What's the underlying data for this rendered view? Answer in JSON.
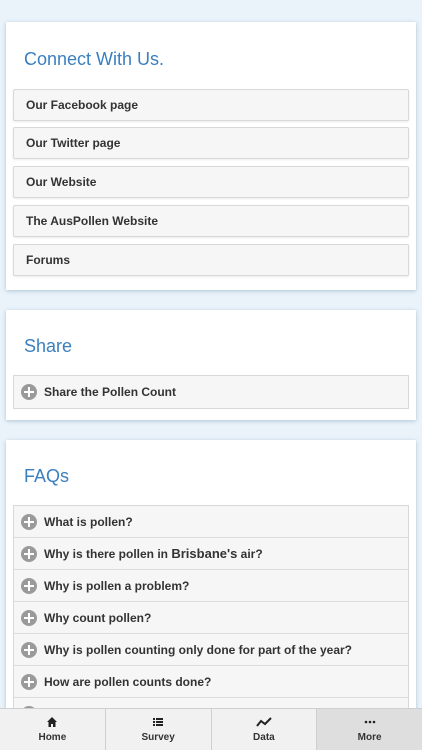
{
  "connect": {
    "title": "Connect With Us.",
    "links": [
      "Our Facebook page",
      "Our Twitter page",
      "Our Website",
      "The AusPollen Website",
      "Forums"
    ]
  },
  "share": {
    "title": "Share",
    "item": "Share the Pollen Count"
  },
  "faqs": {
    "title": "FAQs",
    "items": [
      "What is pollen?",
      {
        "pre": "Why is there pollen in ",
        "em": "Brisbane's",
        "post": " air?"
      },
      "Why is pollen a problem?",
      "Why count pollen?",
      "Why is pollen counting only done for part of the year?",
      "How are pollen counts done?"
    ]
  },
  "nav": {
    "items": [
      {
        "label": "Home",
        "icon": "home-icon"
      },
      {
        "label": "Survey",
        "icon": "list-icon"
      },
      {
        "label": "Data",
        "icon": "trend-icon"
      },
      {
        "label": "More",
        "icon": "more-icon"
      }
    ],
    "active_index": 3
  },
  "colors": {
    "accent": "#3a7fbf",
    "background": "#eaf3fa"
  }
}
